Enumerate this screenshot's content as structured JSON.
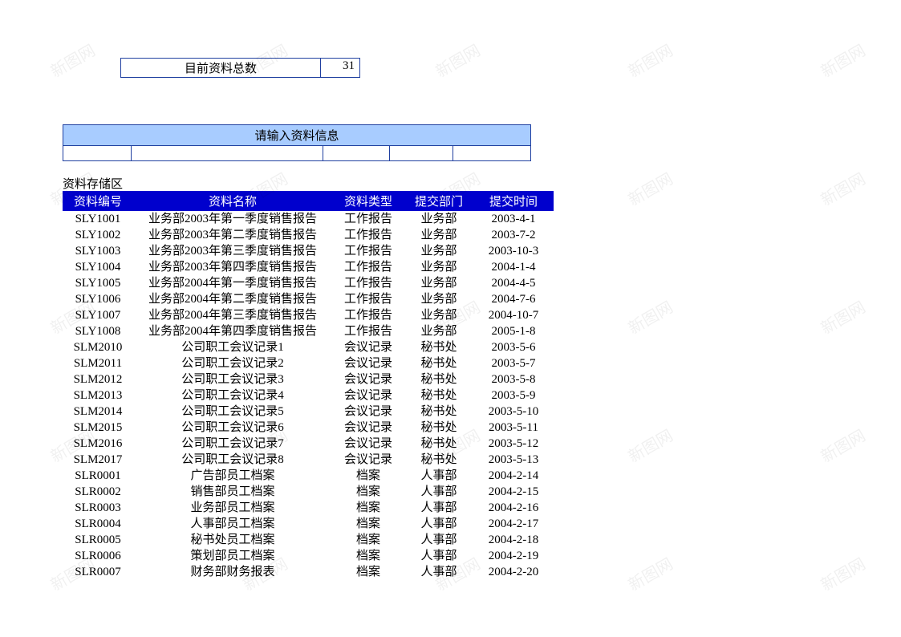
{
  "summary": {
    "label": "目前资料总数",
    "value": "31"
  },
  "inputBanner": {
    "title": "请输入资料信息"
  },
  "storage": {
    "label": "资料存储区"
  },
  "table": {
    "headers": {
      "id": "资料编号",
      "name": "资料名称",
      "type": "资料类型",
      "dept": "提交部门",
      "date": "提交时间"
    },
    "rows": [
      {
        "id": "SLY1001",
        "name": "业务部2003年第一季度销售报告",
        "type": "工作报告",
        "dept": "业务部",
        "date": "2003-4-1"
      },
      {
        "id": "SLY1002",
        "name": "业务部2003年第二季度销售报告",
        "type": "工作报告",
        "dept": "业务部",
        "date": "2003-7-2"
      },
      {
        "id": "SLY1003",
        "name": "业务部2003年第三季度销售报告",
        "type": "工作报告",
        "dept": "业务部",
        "date": "2003-10-3"
      },
      {
        "id": "SLY1004",
        "name": "业务部2003年第四季度销售报告",
        "type": "工作报告",
        "dept": "业务部",
        "date": "2004-1-4"
      },
      {
        "id": "SLY1005",
        "name": "业务部2004年第一季度销售报告",
        "type": "工作报告",
        "dept": "业务部",
        "date": "2004-4-5"
      },
      {
        "id": "SLY1006",
        "name": "业务部2004年第二季度销售报告",
        "type": "工作报告",
        "dept": "业务部",
        "date": "2004-7-6"
      },
      {
        "id": "SLY1007",
        "name": "业务部2004年第三季度销售报告",
        "type": "工作报告",
        "dept": "业务部",
        "date": "2004-10-7"
      },
      {
        "id": "SLY1008",
        "name": "业务部2004年第四季度销售报告",
        "type": "工作报告",
        "dept": "业务部",
        "date": "2005-1-8"
      },
      {
        "id": "SLM2010",
        "name": "公司职工会议记录1",
        "type": "会议记录",
        "dept": "秘书处",
        "date": "2003-5-6"
      },
      {
        "id": "SLM2011",
        "name": "公司职工会议记录2",
        "type": "会议记录",
        "dept": "秘书处",
        "date": "2003-5-7"
      },
      {
        "id": "SLM2012",
        "name": "公司职工会议记录3",
        "type": "会议记录",
        "dept": "秘书处",
        "date": "2003-5-8"
      },
      {
        "id": "SLM2013",
        "name": "公司职工会议记录4",
        "type": "会议记录",
        "dept": "秘书处",
        "date": "2003-5-9"
      },
      {
        "id": "SLM2014",
        "name": "公司职工会议记录5",
        "type": "会议记录",
        "dept": "秘书处",
        "date": "2003-5-10"
      },
      {
        "id": "SLM2015",
        "name": "公司职工会议记录6",
        "type": "会议记录",
        "dept": "秘书处",
        "date": "2003-5-11"
      },
      {
        "id": "SLM2016",
        "name": "公司职工会议记录7",
        "type": "会议记录",
        "dept": "秘书处",
        "date": "2003-5-12"
      },
      {
        "id": "SLM2017",
        "name": "公司职工会议记录8",
        "type": "会议记录",
        "dept": "秘书处",
        "date": "2003-5-13"
      },
      {
        "id": "SLR0001",
        "name": "广告部员工档案",
        "type": "档案",
        "dept": "人事部",
        "date": "2004-2-14"
      },
      {
        "id": "SLR0002",
        "name": "销售部员工档案",
        "type": "档案",
        "dept": "人事部",
        "date": "2004-2-15"
      },
      {
        "id": "SLR0003",
        "name": "业务部员工档案",
        "type": "档案",
        "dept": "人事部",
        "date": "2004-2-16"
      },
      {
        "id": "SLR0004",
        "name": "人事部员工档案",
        "type": "档案",
        "dept": "人事部",
        "date": "2004-2-17"
      },
      {
        "id": "SLR0005",
        "name": "秘书处员工档案",
        "type": "档案",
        "dept": "人事部",
        "date": "2004-2-18"
      },
      {
        "id": "SLR0006",
        "name": "策划部员工档案",
        "type": "档案",
        "dept": "人事部",
        "date": "2004-2-19"
      },
      {
        "id": "SLR0007",
        "name": "财务部财务报表",
        "type": "档案",
        "dept": "人事部",
        "date": "2004-2-20"
      }
    ]
  },
  "watermark": {
    "text": "新图网"
  }
}
